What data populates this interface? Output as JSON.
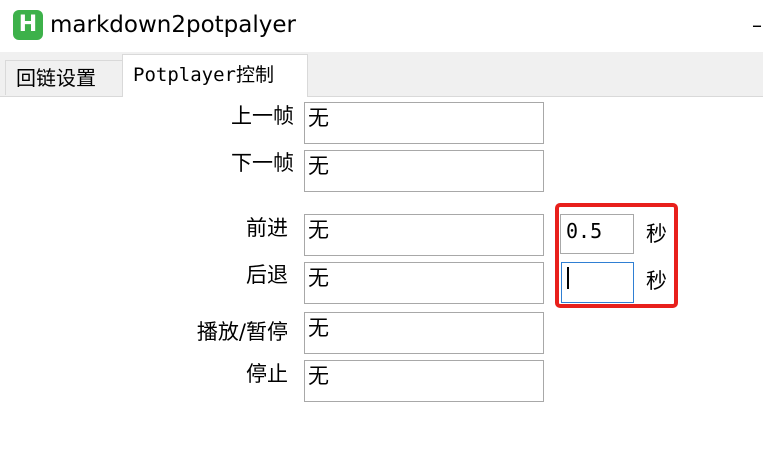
{
  "window": {
    "title": "markdown2potpalyer",
    "icon_letter": "H",
    "icon_color": "#3db14a",
    "minimize_glyph": "–"
  },
  "tabs": [
    {
      "label": "回链设置",
      "active": false
    },
    {
      "label": "Potplayer控制",
      "active": true
    }
  ],
  "form": {
    "prev_frame": {
      "label": "上一帧",
      "value": "无"
    },
    "next_frame": {
      "label": "下一帧",
      "value": "无"
    },
    "forward": {
      "label": "前进",
      "value": "无",
      "seconds": "0.5",
      "unit": "秒"
    },
    "backward": {
      "label": "后退",
      "value": "无",
      "seconds": "",
      "unit": "秒"
    },
    "play_pause": {
      "label": "播放/暂停",
      "value": "无"
    },
    "stop": {
      "label": "停止",
      "value": "无"
    }
  },
  "annotation_color": "#e8201c"
}
